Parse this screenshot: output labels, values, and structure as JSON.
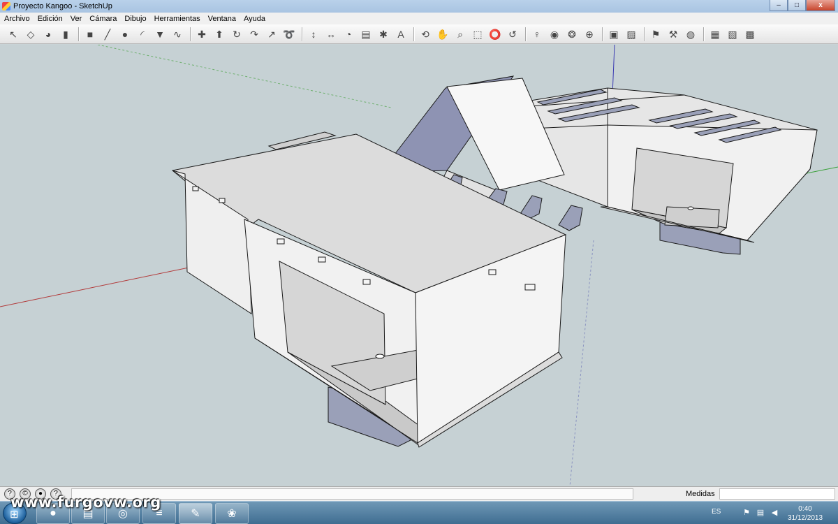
{
  "window": {
    "title": "Proyecto Kangoo - SketchUp",
    "controls": {
      "minimize": "–",
      "maximize": "□",
      "close": "x"
    }
  },
  "menu": [
    "Archivo",
    "Edición",
    "Ver",
    "Cámara",
    "Dibujo",
    "Herramientas",
    "Ventana",
    "Ayuda"
  ],
  "toolbar": {
    "tools": [
      {
        "name": "select-tool-icon",
        "glyph": "↖"
      },
      {
        "name": "make-component-icon",
        "glyph": "◇"
      },
      {
        "name": "paint-bucket-icon",
        "glyph": "◕"
      },
      {
        "name": "eraser-icon",
        "glyph": "▮"
      },
      {
        "sep": true
      },
      {
        "name": "rectangle-tool-icon",
        "glyph": "■"
      },
      {
        "name": "line-tool-icon",
        "glyph": "╱"
      },
      {
        "name": "circle-tool-icon",
        "glyph": "●"
      },
      {
        "name": "arc-tool-icon",
        "glyph": "◜"
      },
      {
        "name": "polygon-tool-icon",
        "glyph": "▼"
      },
      {
        "name": "freehand-tool-icon",
        "glyph": "∿"
      },
      {
        "sep": true
      },
      {
        "name": "move-tool-icon",
        "glyph": "✚"
      },
      {
        "name": "push-pull-icon",
        "glyph": "⬆"
      },
      {
        "name": "rotate-tool-icon",
        "glyph": "↻"
      },
      {
        "name": "follow-me-icon",
        "glyph": "↷"
      },
      {
        "name": "scale-tool-icon",
        "glyph": "↗"
      },
      {
        "name": "offset-tool-icon",
        "glyph": "➰"
      },
      {
        "sep": true
      },
      {
        "name": "tape-measure-icon",
        "glyph": "↕"
      },
      {
        "name": "dimension-tool-icon",
        "glyph": "↔"
      },
      {
        "name": "protractor-icon",
        "glyph": "◔"
      },
      {
        "name": "text-tool-icon",
        "glyph": "▤"
      },
      {
        "name": "axes-tool-icon",
        "glyph": "✱"
      },
      {
        "name": "3d-text-icon",
        "glyph": "A"
      },
      {
        "sep": true
      },
      {
        "name": "orbit-tool-icon",
        "glyph": "⟲"
      },
      {
        "name": "pan-tool-icon",
        "glyph": "✋"
      },
      {
        "name": "zoom-tool-icon",
        "glyph": "⌕"
      },
      {
        "name": "zoom-window-icon",
        "glyph": "⬚"
      },
      {
        "name": "zoom-extents-icon",
        "glyph": "⭕"
      },
      {
        "name": "previous-view-icon",
        "glyph": "↺"
      },
      {
        "sep": true
      },
      {
        "name": "position-camera-icon",
        "glyph": "♀"
      },
      {
        "name": "look-around-icon",
        "glyph": "◉"
      },
      {
        "name": "walk-tool-icon",
        "glyph": "❂"
      },
      {
        "name": "section-plane-icon",
        "glyph": "⊕"
      },
      {
        "sep": true
      },
      {
        "name": "get-models-icon",
        "glyph": "▣"
      },
      {
        "name": "share-model-icon",
        "glyph": "▨"
      },
      {
        "sep": true
      },
      {
        "name": "add-location-icon",
        "glyph": "⚑"
      },
      {
        "name": "toggle-terrain-icon",
        "glyph": "⚒"
      },
      {
        "name": "google-earth-icon",
        "glyph": "◍"
      },
      {
        "sep": true
      },
      {
        "name": "warehouse-icon",
        "glyph": "▦"
      },
      {
        "name": "component-share-icon",
        "glyph": "▧"
      },
      {
        "name": "extension-icon",
        "glyph": "▩"
      }
    ]
  },
  "statusbar": {
    "icons": [
      "geo-icon",
      "credits-icon",
      "user-icon",
      "help-icon"
    ],
    "measure_label": "Medidas",
    "measure_value": ""
  },
  "taskbar": {
    "items": [
      {
        "name": "firefox-icon",
        "glyph": "●"
      },
      {
        "name": "explorer-folder-icon",
        "glyph": "▤"
      },
      {
        "name": "chrome-icon",
        "glyph": "◎"
      },
      {
        "name": "spotify-icon",
        "glyph": "≡"
      },
      {
        "name": "sketchup-task-icon",
        "glyph": "✎"
      },
      {
        "name": "paint-task-icon",
        "glyph": "❀"
      }
    ],
    "language": "ES",
    "clock_time": "0:40",
    "clock_date": "31/12/2013"
  },
  "watermark": "www.furgovw.org",
  "colors": {
    "sky": "#c6d1d4",
    "face_light": "#efefef",
    "face_mid": "#dcdcdc",
    "face_back": "#9aa0b8",
    "edge": "#1a1a1a",
    "axis_red": "#b23a3a",
    "axis_green": "#3aa13a",
    "axis_blue": "#3a3ab2"
  }
}
